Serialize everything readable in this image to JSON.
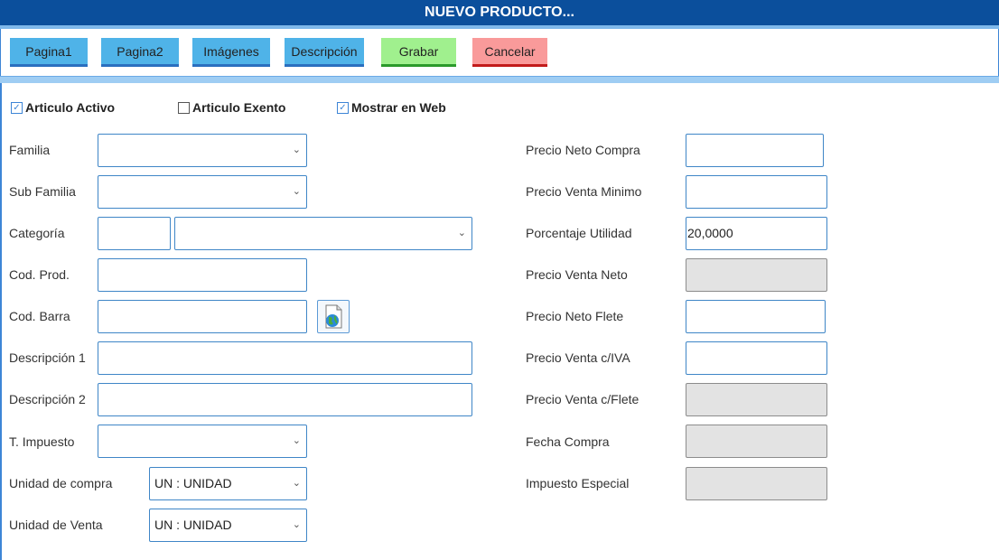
{
  "window": {
    "title": "NUEVO PRODUCTO..."
  },
  "toolbar": {
    "pagina1": "Pagina1",
    "pagina2": "Pagina2",
    "imagenes": "Imágenes",
    "descripcion": "Descripción",
    "grabar": "Grabar",
    "cancelar": "Cancelar"
  },
  "checkboxes": {
    "activo": {
      "label": "Articulo Activo",
      "checked": true
    },
    "exento": {
      "label": "Articulo Exento",
      "checked": false
    },
    "web": {
      "label": "Mostrar en Web",
      "checked": true
    }
  },
  "left": {
    "familia": {
      "label": "Familia",
      "value": ""
    },
    "subfamilia": {
      "label": "Sub Familia",
      "value": ""
    },
    "categoria": {
      "label": "Categoría",
      "code": "",
      "value": ""
    },
    "codprod": {
      "label": "Cod. Prod.",
      "value": ""
    },
    "codbarra": {
      "label": "Cod. Barra",
      "value": ""
    },
    "desc1": {
      "label": "Descripción 1",
      "value": ""
    },
    "desc2": {
      "label": "Descripción 2",
      "value": ""
    },
    "impuesto": {
      "label": "T. Impuesto",
      "value": ""
    },
    "unidad_compra": {
      "label": "Unidad de compra",
      "value": "UN : UNIDAD"
    },
    "unidad_venta": {
      "label": "Unidad de Venta",
      "value": "UN : UNIDAD"
    }
  },
  "right": {
    "neto_compra": {
      "label": "Precio Neto Compra",
      "value": ""
    },
    "venta_minimo": {
      "label": "Precio Venta Minimo",
      "value": ""
    },
    "utilidad": {
      "label": "Porcentaje Utilidad",
      "value": "20,0000"
    },
    "venta_neto": {
      "label": "Precio Venta Neto",
      "value": ""
    },
    "neto_flete": {
      "label": "Precio Neto Flete",
      "value": ""
    },
    "venta_iva": {
      "label": "Precio Venta c/IVA",
      "value": ""
    },
    "venta_flete": {
      "label": "Precio Venta c/Flete",
      "value": ""
    },
    "fecha_compra": {
      "label": "Fecha Compra",
      "value": ""
    },
    "impuesto_especial": {
      "label": "Impuesto Especial",
      "value": ""
    }
  },
  "icons": {
    "dropdown": "chevron-down-icon",
    "barcode_generator": "globe-document-icon"
  },
  "colors": {
    "titlebar": "#0b4f9c",
    "blue_button": "#4fb3e8",
    "save_button": "#a0f08e",
    "cancel_button": "#f99a9a",
    "field_border": "#3f86c7",
    "disabled_field": "#e3e3e3"
  }
}
